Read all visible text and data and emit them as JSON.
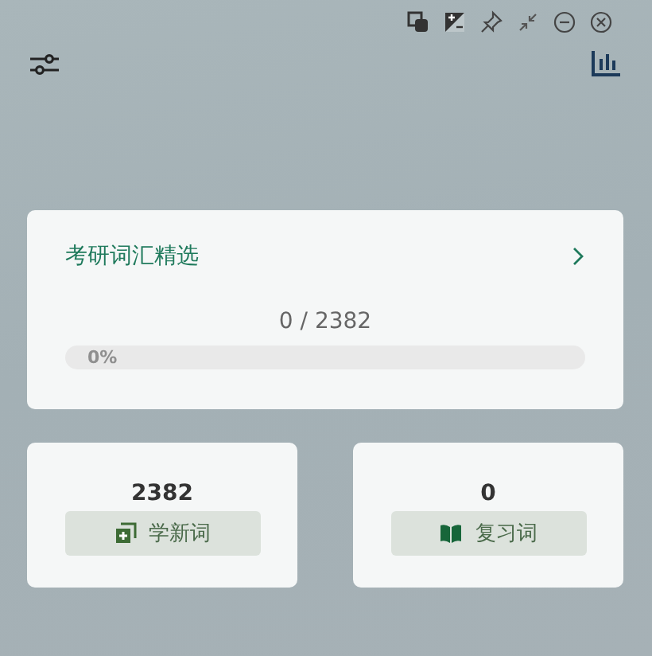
{
  "book": {
    "title": "考研词汇精选",
    "progress_text": "0 / 2382",
    "level": 0,
    "percent": "0%"
  },
  "actions": [
    {
      "kind": "learn",
      "count": "2382",
      "label": "学新词"
    },
    {
      "kind": "review",
      "count": "0",
      "label": "复习词"
    }
  ]
}
